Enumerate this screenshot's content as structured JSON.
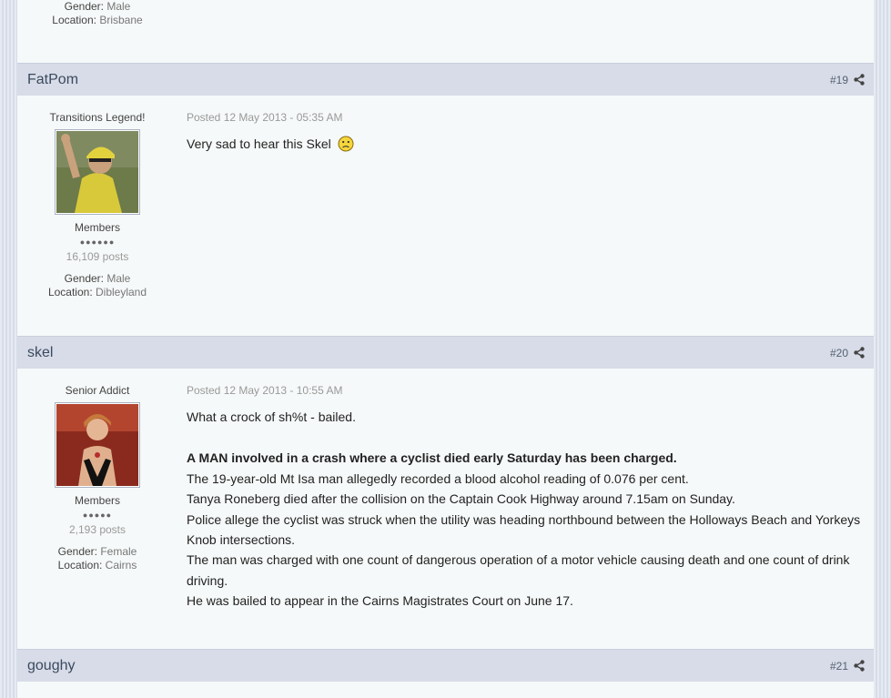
{
  "prev_post": {
    "gender_label": "Gender:",
    "gender": "Male",
    "location_label": "Location:",
    "location": "Brisbane"
  },
  "posts": [
    {
      "author": "FatPom",
      "number": "#19",
      "rank": "Transitions Legend!",
      "group": "Members",
      "pips": "●●●●●●",
      "post_count": "16,109 posts",
      "gender_label": "Gender:",
      "gender": "Male",
      "location_label": "Location:",
      "location": "Dibleyland",
      "date": "Posted 12 May 2013 - 05:35 AM",
      "body": "Very sad to hear this Skel"
    },
    {
      "author": "skel",
      "number": "#20",
      "rank": "Senior Addict",
      "group": "Members",
      "pips": "●●●●●",
      "post_count": "2,193 posts",
      "gender_label": "Gender:",
      "gender": "Female",
      "location_label": "Location:",
      "location": "Cairns",
      "date": "Posted 12 May 2013 - 10:55 AM",
      "intro": "What a crock of sh%t - bailed.",
      "headline": "A MAN involved in a crash where a cyclist died early Saturday has been charged.",
      "lines": [
        "The 19-year-old Mt Isa man allegedly recorded a blood alcohol reading of 0.076 per cent.",
        "Tanya Roneberg died after the collision on the Captain Cook Highway around 7.15am on Sunday.",
        "Police allege the cyclist was struck when the utility was heading northbound between the Holloways Beach and Yorkeys Knob intersections.",
        "The man was charged with one count of dangerous operation of a motor vehicle causing death and one count of drink driving.",
        "He was bailed to appear in the Cairns Magistrates Court on June 17."
      ]
    },
    {
      "author": "goughy",
      "number": "#21"
    }
  ],
  "icons": {
    "share": "share-icon",
    "smiley": "sad-smiley-icon"
  },
  "colors": {
    "header_bg": "#d7dce8",
    "post_bg": "#f6f9f9",
    "author_text": "#3b4a5e"
  }
}
